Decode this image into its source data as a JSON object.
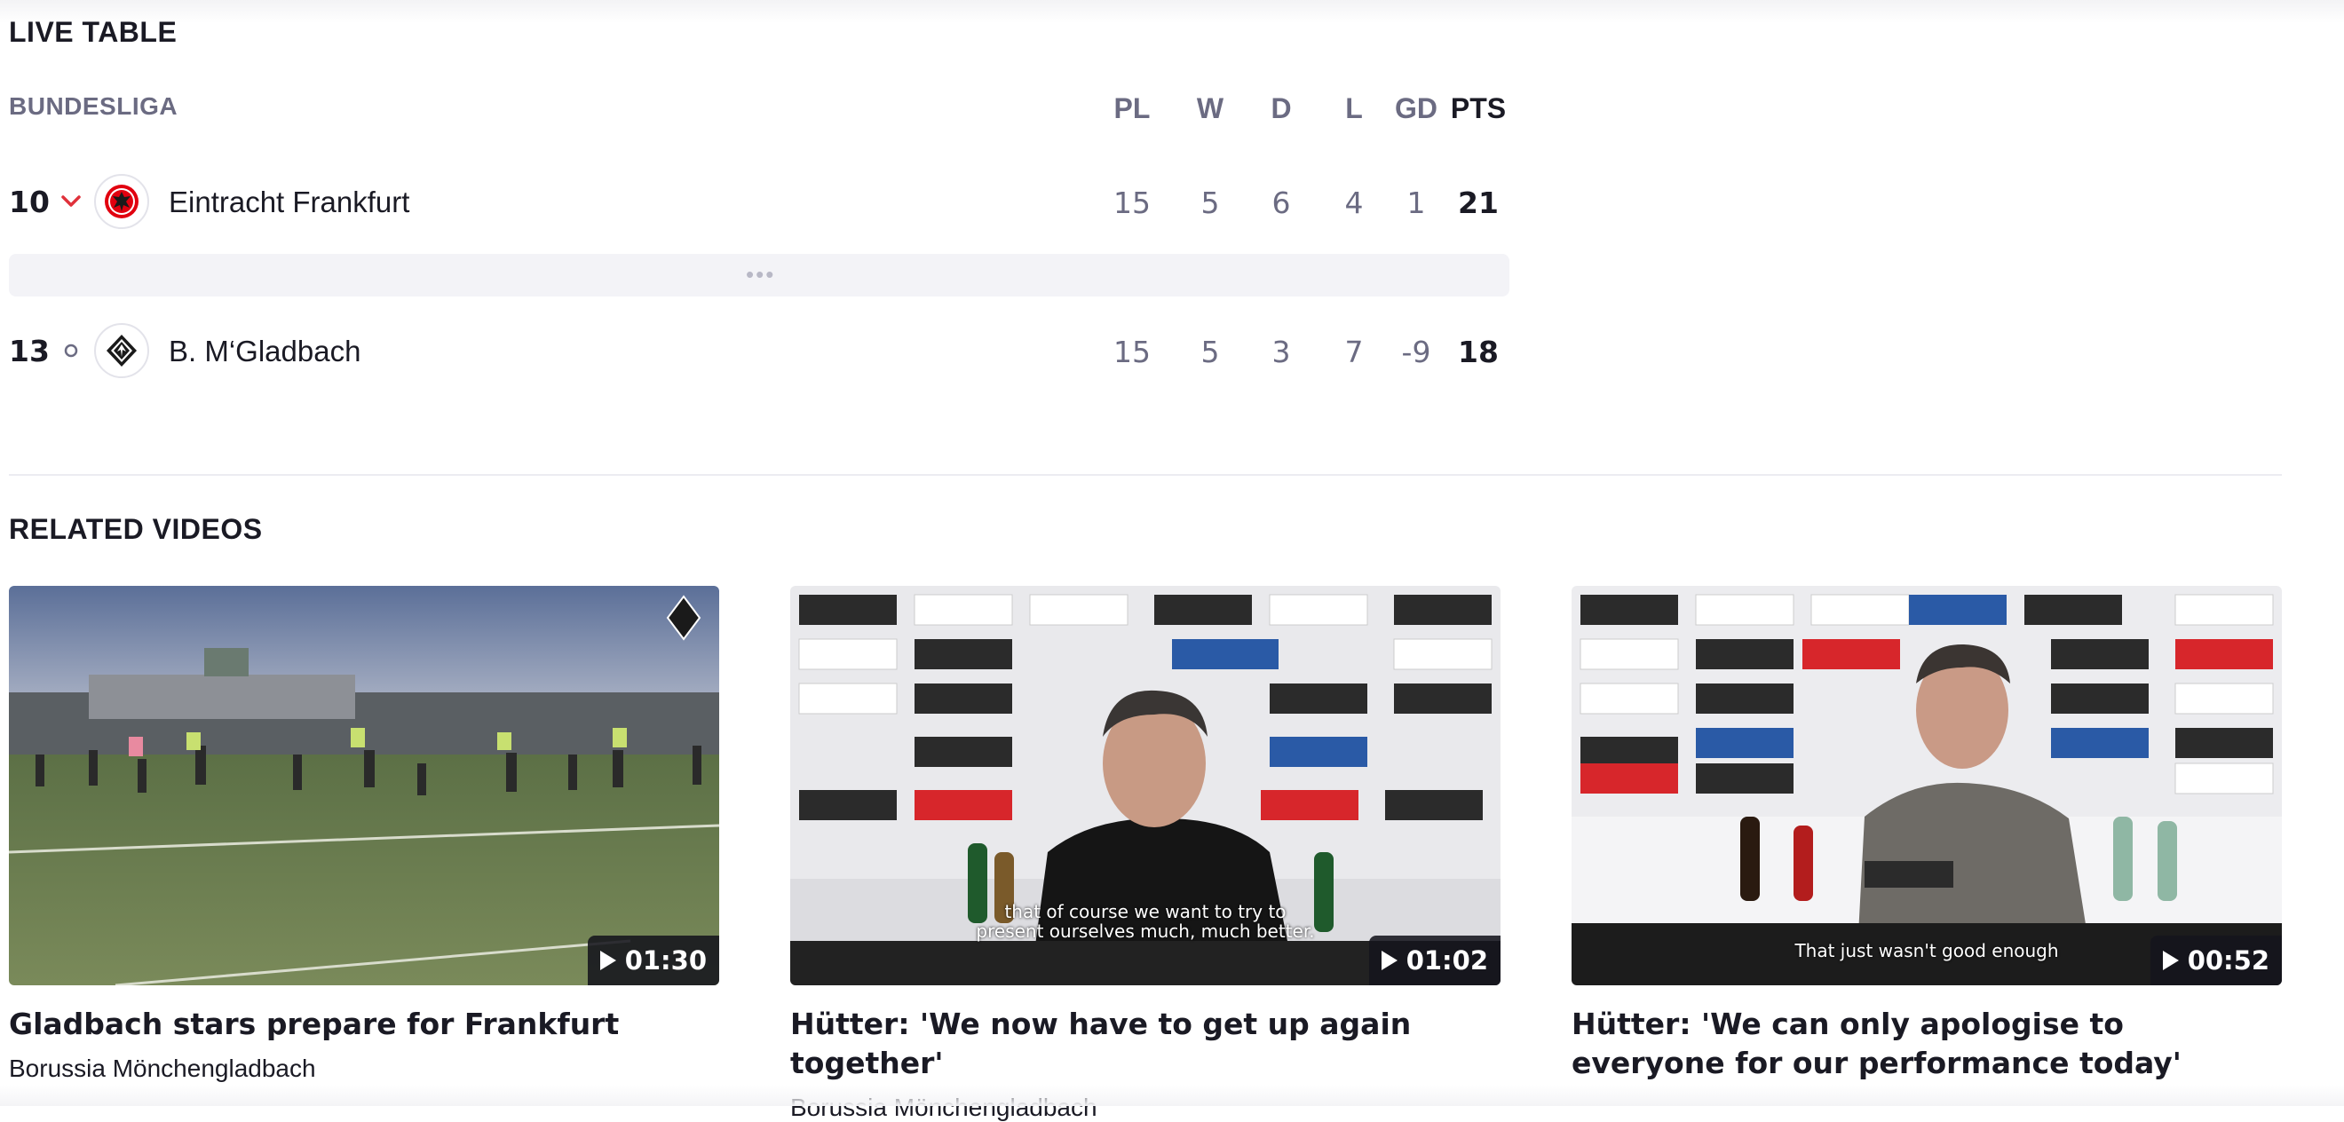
{
  "live_table": {
    "title": "LIVE TABLE",
    "league": "BUNDESLIGA",
    "columns": [
      "PL",
      "W",
      "D",
      "L",
      "GD",
      "PTS"
    ],
    "rows": [
      {
        "position": "10",
        "trend": "down",
        "trend_icon": "chevron-down-icon",
        "team": "Eintracht Frankfurt",
        "crest_icon": "eagle-crest-icon",
        "pl": "15",
        "w": "5",
        "d": "6",
        "l": "4",
        "gd": "1",
        "pts": "21"
      },
      {
        "position": "13",
        "trend": "same",
        "trend_icon": "circle-icon",
        "team": "B. M‘Gladbach",
        "crest_icon": "foal-crest-icon",
        "pl": "15",
        "w": "5",
        "d": "3",
        "l": "7",
        "gd": "-9",
        "pts": "18"
      }
    ],
    "expand_label": "•••"
  },
  "related_videos": {
    "title": "RELATED VIDEOS",
    "items": [
      {
        "title": "Gladbach stars prepare for Frankfurt",
        "channel": "Borussia Mönchengladbach",
        "duration": "01:30",
        "subtitle": ""
      },
      {
        "title": "Hütter: 'We now have to get up again together'",
        "channel": "Borussia Mönchengladbach",
        "duration": "01:02",
        "subtitle_line1": "that of course we want to try to",
        "subtitle_line2": "present ourselves much, much better."
      },
      {
        "title": "Hütter: 'We can only apologise to everyone for our performance today'",
        "channel": "",
        "duration": "00:52",
        "subtitle_line1": "That just wasn't good enough"
      }
    ]
  },
  "colors": {
    "trend_down": "#e0313b",
    "muted_text": "#6b6b82",
    "duration_bg": "#14141e"
  }
}
